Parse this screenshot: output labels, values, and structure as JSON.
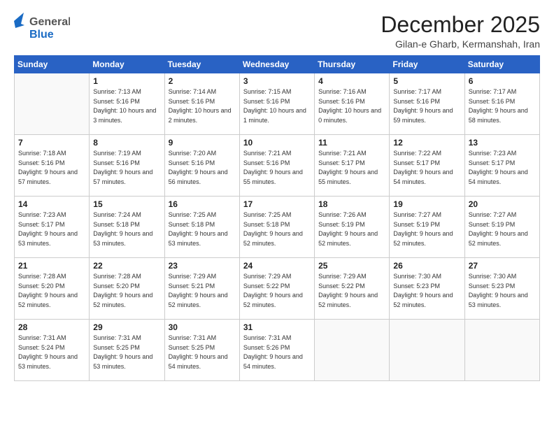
{
  "header": {
    "logo_general": "General",
    "logo_blue": "Blue",
    "month_title": "December 2025",
    "location": "Gilan-e Gharb, Kermanshah, Iran"
  },
  "days_of_week": [
    "Sunday",
    "Monday",
    "Tuesday",
    "Wednesday",
    "Thursday",
    "Friday",
    "Saturday"
  ],
  "weeks": [
    [
      {
        "num": "",
        "sunrise": "",
        "sunset": "",
        "daylight": ""
      },
      {
        "num": "1",
        "sunrise": "Sunrise: 7:13 AM",
        "sunset": "Sunset: 5:16 PM",
        "daylight": "Daylight: 10 hours and 3 minutes."
      },
      {
        "num": "2",
        "sunrise": "Sunrise: 7:14 AM",
        "sunset": "Sunset: 5:16 PM",
        "daylight": "Daylight: 10 hours and 2 minutes."
      },
      {
        "num": "3",
        "sunrise": "Sunrise: 7:15 AM",
        "sunset": "Sunset: 5:16 PM",
        "daylight": "Daylight: 10 hours and 1 minute."
      },
      {
        "num": "4",
        "sunrise": "Sunrise: 7:16 AM",
        "sunset": "Sunset: 5:16 PM",
        "daylight": "Daylight: 10 hours and 0 minutes."
      },
      {
        "num": "5",
        "sunrise": "Sunrise: 7:17 AM",
        "sunset": "Sunset: 5:16 PM",
        "daylight": "Daylight: 9 hours and 59 minutes."
      },
      {
        "num": "6",
        "sunrise": "Sunrise: 7:17 AM",
        "sunset": "Sunset: 5:16 PM",
        "daylight": "Daylight: 9 hours and 58 minutes."
      }
    ],
    [
      {
        "num": "7",
        "sunrise": "Sunrise: 7:18 AM",
        "sunset": "Sunset: 5:16 PM",
        "daylight": "Daylight: 9 hours and 57 minutes."
      },
      {
        "num": "8",
        "sunrise": "Sunrise: 7:19 AM",
        "sunset": "Sunset: 5:16 PM",
        "daylight": "Daylight: 9 hours and 57 minutes."
      },
      {
        "num": "9",
        "sunrise": "Sunrise: 7:20 AM",
        "sunset": "Sunset: 5:16 PM",
        "daylight": "Daylight: 9 hours and 56 minutes."
      },
      {
        "num": "10",
        "sunrise": "Sunrise: 7:21 AM",
        "sunset": "Sunset: 5:16 PM",
        "daylight": "Daylight: 9 hours and 55 minutes."
      },
      {
        "num": "11",
        "sunrise": "Sunrise: 7:21 AM",
        "sunset": "Sunset: 5:17 PM",
        "daylight": "Daylight: 9 hours and 55 minutes."
      },
      {
        "num": "12",
        "sunrise": "Sunrise: 7:22 AM",
        "sunset": "Sunset: 5:17 PM",
        "daylight": "Daylight: 9 hours and 54 minutes."
      },
      {
        "num": "13",
        "sunrise": "Sunrise: 7:23 AM",
        "sunset": "Sunset: 5:17 PM",
        "daylight": "Daylight: 9 hours and 54 minutes."
      }
    ],
    [
      {
        "num": "14",
        "sunrise": "Sunrise: 7:23 AM",
        "sunset": "Sunset: 5:17 PM",
        "daylight": "Daylight: 9 hours and 53 minutes."
      },
      {
        "num": "15",
        "sunrise": "Sunrise: 7:24 AM",
        "sunset": "Sunset: 5:18 PM",
        "daylight": "Daylight: 9 hours and 53 minutes."
      },
      {
        "num": "16",
        "sunrise": "Sunrise: 7:25 AM",
        "sunset": "Sunset: 5:18 PM",
        "daylight": "Daylight: 9 hours and 53 minutes."
      },
      {
        "num": "17",
        "sunrise": "Sunrise: 7:25 AM",
        "sunset": "Sunset: 5:18 PM",
        "daylight": "Daylight: 9 hours and 52 minutes."
      },
      {
        "num": "18",
        "sunrise": "Sunrise: 7:26 AM",
        "sunset": "Sunset: 5:19 PM",
        "daylight": "Daylight: 9 hours and 52 minutes."
      },
      {
        "num": "19",
        "sunrise": "Sunrise: 7:27 AM",
        "sunset": "Sunset: 5:19 PM",
        "daylight": "Daylight: 9 hours and 52 minutes."
      },
      {
        "num": "20",
        "sunrise": "Sunrise: 7:27 AM",
        "sunset": "Sunset: 5:19 PM",
        "daylight": "Daylight: 9 hours and 52 minutes."
      }
    ],
    [
      {
        "num": "21",
        "sunrise": "Sunrise: 7:28 AM",
        "sunset": "Sunset: 5:20 PM",
        "daylight": "Daylight: 9 hours and 52 minutes."
      },
      {
        "num": "22",
        "sunrise": "Sunrise: 7:28 AM",
        "sunset": "Sunset: 5:20 PM",
        "daylight": "Daylight: 9 hours and 52 minutes."
      },
      {
        "num": "23",
        "sunrise": "Sunrise: 7:29 AM",
        "sunset": "Sunset: 5:21 PM",
        "daylight": "Daylight: 9 hours and 52 minutes."
      },
      {
        "num": "24",
        "sunrise": "Sunrise: 7:29 AM",
        "sunset": "Sunset: 5:22 PM",
        "daylight": "Daylight: 9 hours and 52 minutes."
      },
      {
        "num": "25",
        "sunrise": "Sunrise: 7:29 AM",
        "sunset": "Sunset: 5:22 PM",
        "daylight": "Daylight: 9 hours and 52 minutes."
      },
      {
        "num": "26",
        "sunrise": "Sunrise: 7:30 AM",
        "sunset": "Sunset: 5:23 PM",
        "daylight": "Daylight: 9 hours and 52 minutes."
      },
      {
        "num": "27",
        "sunrise": "Sunrise: 7:30 AM",
        "sunset": "Sunset: 5:23 PM",
        "daylight": "Daylight: 9 hours and 53 minutes."
      }
    ],
    [
      {
        "num": "28",
        "sunrise": "Sunrise: 7:31 AM",
        "sunset": "Sunset: 5:24 PM",
        "daylight": "Daylight: 9 hours and 53 minutes."
      },
      {
        "num": "29",
        "sunrise": "Sunrise: 7:31 AM",
        "sunset": "Sunset: 5:25 PM",
        "daylight": "Daylight: 9 hours and 53 minutes."
      },
      {
        "num": "30",
        "sunrise": "Sunrise: 7:31 AM",
        "sunset": "Sunset: 5:25 PM",
        "daylight": "Daylight: 9 hours and 54 minutes."
      },
      {
        "num": "31",
        "sunrise": "Sunrise: 7:31 AM",
        "sunset": "Sunset: 5:26 PM",
        "daylight": "Daylight: 9 hours and 54 minutes."
      },
      {
        "num": "",
        "sunrise": "",
        "sunset": "",
        "daylight": ""
      },
      {
        "num": "",
        "sunrise": "",
        "sunset": "",
        "daylight": ""
      },
      {
        "num": "",
        "sunrise": "",
        "sunset": "",
        "daylight": ""
      }
    ]
  ]
}
